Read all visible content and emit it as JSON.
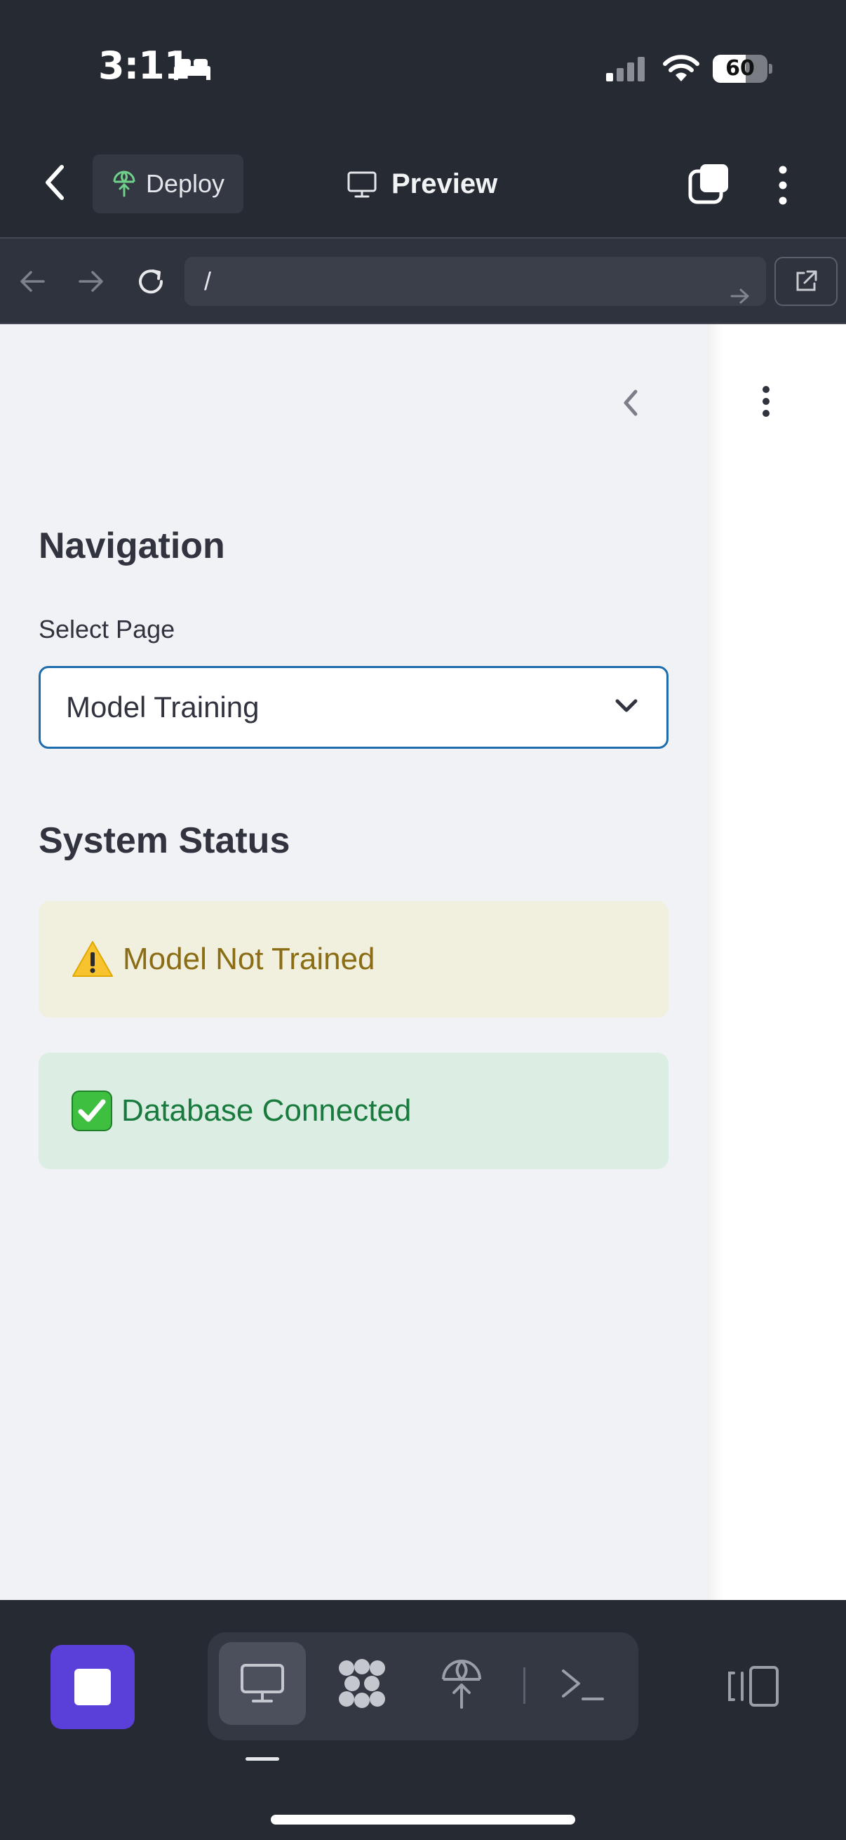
{
  "status_bar": {
    "time": "3:11",
    "battery_percent": "60",
    "battery_level": 0.6,
    "icons": [
      "bed-icon",
      "signal-icon",
      "wifi-icon",
      "battery-icon"
    ]
  },
  "header": {
    "deploy_label": "Deploy",
    "title": "Preview",
    "icons": [
      "back-chevron-icon",
      "deploy-icon",
      "monitor-icon",
      "tabs-icon",
      "more-vertical-icon"
    ]
  },
  "browser": {
    "url": "/",
    "icons": [
      "arrow-left-icon",
      "arrow-right-icon",
      "reload-icon",
      "go-arrow-icon",
      "external-link-icon"
    ]
  },
  "sidebar": {
    "navigation_heading": "Navigation",
    "select_label": "Select Page",
    "selected_page": "Model Training",
    "status_heading": "System Status",
    "alerts": [
      {
        "type": "warning",
        "icon": "warning-icon",
        "text": "Model Not Trained"
      },
      {
        "type": "success",
        "icon": "check-box-icon",
        "text": "Database Connected"
      }
    ]
  },
  "bottom_bar": {
    "icons": [
      "stop-icon",
      "monitor-icon",
      "packages-icon",
      "deploy-icon",
      "terminal-icon",
      "split-view-icon"
    ],
    "active_tool": "monitor"
  },
  "colors": {
    "accent": "#5b3fd9",
    "select_border": "#1f6cad",
    "warning_bg": "#f1efde",
    "warning_text": "#8a6d14",
    "success_bg": "#dcede4",
    "success_text": "#197a3d"
  }
}
